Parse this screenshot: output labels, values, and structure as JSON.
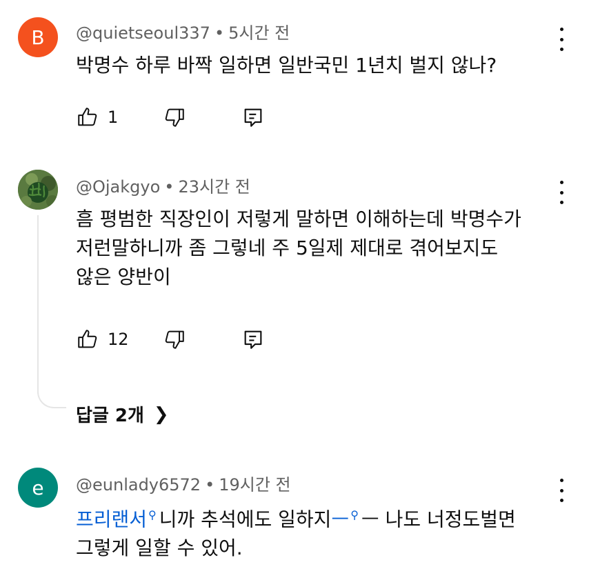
{
  "comments": [
    {
      "avatar_letter": "B",
      "avatar_color": "#f4511e",
      "author": "@quietseoul337",
      "time": "5시간 전",
      "lines": [
        "박명수 하루 바짝 일하면 일반국민 1년치 벌지 않나?"
      ],
      "likes": "1"
    },
    {
      "avatar_letter": "",
      "avatar_color": "#4f6b3a",
      "author": "@Ojakgyo",
      "time": "23시간 전",
      "lines": [
        "흠 평범한 직장인이 저렇게 말하면 이해하는데 박명수가",
        "저런말하니까 좀 그렇네 주 5일제 제대로 겪어보지도",
        "않은 양반이"
      ],
      "likes": "12",
      "replies_label": "답글 2개"
    },
    {
      "avatar_letter": "e",
      "avatar_color": "#00897b",
      "author": "@eunlady6572",
      "time": "19시간 전",
      "line1": {
        "link1": "프리랜서",
        "mid": "니까 추석에도 일하지",
        "link2": "ㅡ",
        "rest": "ㅡ 나도 너정도벌면"
      },
      "line2": "그렇게 일할 수 있어."
    }
  ],
  "separator": "•",
  "icons": [
    "like-icon",
    "dislike-icon",
    "reply-icon",
    "more-vert-icon",
    "chevron-right-icon",
    "search-icon"
  ]
}
